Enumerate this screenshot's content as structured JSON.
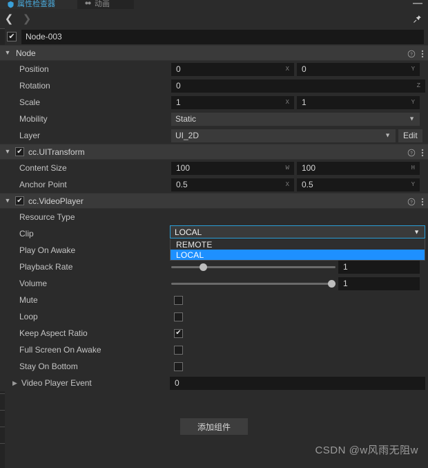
{
  "window": {
    "background": "#2b2b2b",
    "accent": "#1e90ff",
    "focus_border": "#2b9fd8"
  },
  "tabs": [
    {
      "label": "属性检查器",
      "icon": "inspector-icon",
      "active": true
    },
    {
      "label": "动画",
      "icon": "animation-icon",
      "active": false
    }
  ],
  "titlebar": {
    "minimize_icon": "minimize-icon",
    "pin_icon": "pin-icon"
  },
  "nav": {
    "back_icon": "chevron-left-icon",
    "forward_icon": "chevron-right-icon"
  },
  "node": {
    "enabled": true,
    "name": "Node-003"
  },
  "sections": [
    {
      "id": "node",
      "title": "Node",
      "expanded": true,
      "has_checkbox": false,
      "checked": false,
      "help_icon": "help-circle-icon",
      "menu_icon": "more-vertical-icon",
      "rows": [
        {
          "type": "vec2",
          "label": "Position",
          "fields": [
            {
              "value": "0",
              "axis": "X"
            },
            {
              "value": "0",
              "axis": "Y"
            }
          ]
        },
        {
          "type": "vec1",
          "label": "Rotation",
          "fields": [
            {
              "value": "0",
              "axis": "Z"
            }
          ]
        },
        {
          "type": "vec2",
          "label": "Scale",
          "fields": [
            {
              "value": "1",
              "axis": "X"
            },
            {
              "value": "1",
              "axis": "Y"
            }
          ]
        },
        {
          "type": "select",
          "label": "Mobility",
          "value": "Static",
          "chevron": "chevron-down-icon"
        },
        {
          "type": "select-edit",
          "label": "Layer",
          "value": "UI_2D",
          "chevron": "chevron-down-icon",
          "button": "Edit"
        }
      ]
    },
    {
      "id": "ui-transform",
      "title": "cc.UITransform",
      "expanded": true,
      "has_checkbox": true,
      "checked": true,
      "help_icon": "help-circle-icon",
      "menu_icon": "more-vertical-icon",
      "rows": [
        {
          "type": "vec2",
          "label": "Content Size",
          "fields": [
            {
              "value": "100",
              "axis": "W"
            },
            {
              "value": "100",
              "axis": "H"
            }
          ]
        },
        {
          "type": "vec2",
          "label": "Anchor Point",
          "fields": [
            {
              "value": "0.5",
              "axis": "X"
            },
            {
              "value": "0.5",
              "axis": "Y"
            }
          ]
        }
      ]
    },
    {
      "id": "video-player",
      "title": "cc.VideoPlayer",
      "expanded": true,
      "has_checkbox": true,
      "checked": true,
      "help_icon": "help-circle-icon",
      "menu_icon": "more-vertical-icon",
      "rows": [
        {
          "type": "select-open",
          "label": "Resource Type",
          "value": "LOCAL",
          "chevron": "chevron-down-icon",
          "options": [
            {
              "label": "REMOTE",
              "selected": false
            },
            {
              "label": "LOCAL",
              "selected": true
            }
          ]
        },
        {
          "type": "empty",
          "label": "Clip"
        },
        {
          "type": "checkbox",
          "label": "Play On Awake",
          "checked": true
        },
        {
          "type": "slider",
          "label": "Playback Rate",
          "value": "1",
          "fill_percent": 18
        },
        {
          "type": "slider",
          "label": "Volume",
          "value": "1",
          "fill_percent": 100
        },
        {
          "type": "checkbox",
          "label": "Mute",
          "checked": false
        },
        {
          "type": "checkbox",
          "label": "Loop",
          "checked": false
        },
        {
          "type": "checkbox",
          "label": "Keep Aspect Ratio",
          "checked": true
        },
        {
          "type": "checkbox",
          "label": "Full Screen On Awake",
          "checked": false
        },
        {
          "type": "checkbox",
          "label": "Stay On Bottom",
          "checked": false
        },
        {
          "type": "expandable",
          "label": "Video Player Event",
          "value": "0",
          "triangle": "chevron-right-icon"
        }
      ]
    }
  ],
  "footer": {
    "add_component_label": "添加组件"
  },
  "watermark": "CSDN @w风雨无阻w"
}
